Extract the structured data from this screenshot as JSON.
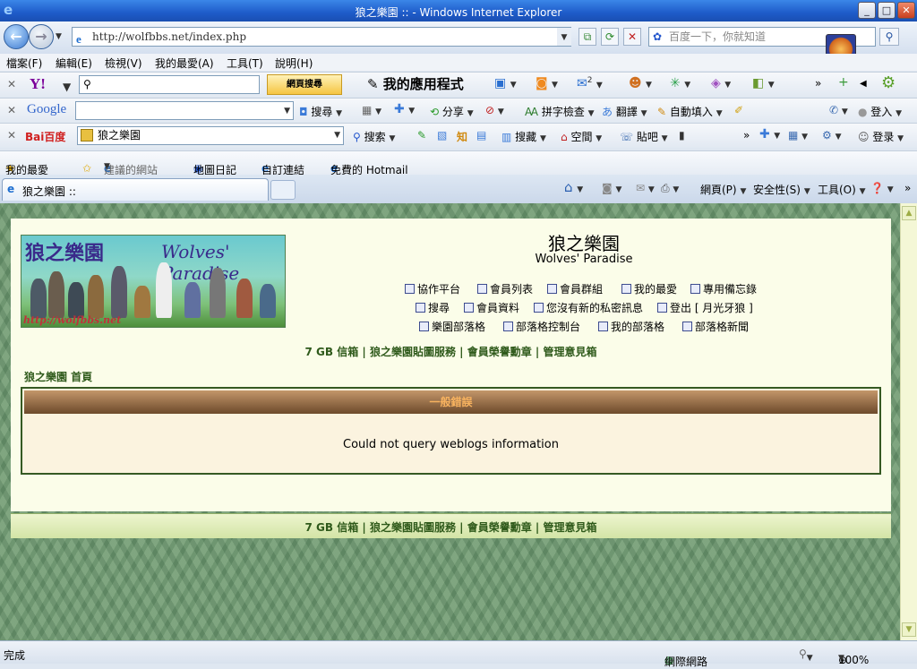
{
  "window": {
    "title": "狼之樂園 :: - Windows Internet Explorer"
  },
  "address": {
    "url": "http://wolfbbs.net/index.php",
    "search_placeholder": "百度一下，你就知道"
  },
  "menu": [
    "檔案(F)",
    "編輯(E)",
    "檢視(V)",
    "我的最愛(A)",
    "工具(T)",
    "說明(H)"
  ],
  "yahoo_toolbar": {
    "logo": "Y!",
    "search_button": "網頁搜尋",
    "apps_label": "我的應用程式",
    "mail_badge": "2"
  },
  "google_toolbar": {
    "logo": "Google",
    "search": "搜尋",
    "share": "分享",
    "spellcheck": "拼字檢查",
    "translate": "翻譯",
    "autofill": "自動填入",
    "login": "登入"
  },
  "baidu_toolbar": {
    "logo": "Bai百度",
    "field": "狼之樂園",
    "search": "搜索",
    "collect": "搜藏",
    "space": "空間",
    "tieba": "貼吧",
    "login": "登录"
  },
  "favorites": {
    "fav": "我的最愛",
    "suggested": "建議的網站",
    "map": "地圖日記",
    "custom": "自訂連結",
    "hotmail": "免費的 Hotmail"
  },
  "tab": {
    "title": "狼之樂園 ::"
  },
  "commandbar": {
    "page": "網頁(P)",
    "safety": "安全性(S)",
    "tools": "工具(O)"
  },
  "site": {
    "logo_cn": "狼之樂園",
    "logo_en": "Wolves' Paradise",
    "logo_url": "http://wolfbbs.net",
    "title": "狼之樂園",
    "subtitle": "Wolves' Paradise",
    "nav_row1": [
      "協作平台",
      "會員列表",
      "會員群組",
      "我的最愛",
      "專用備忘錄"
    ],
    "nav_row2": [
      "搜尋",
      "會員資料",
      "您沒有新的私密訊息",
      "登出 [ 月光牙狼 ]"
    ],
    "nav_row3": [
      "樂園部落格",
      "部落格控制台",
      "我的部落格",
      "部落格新聞"
    ],
    "bottom_links": "7 GB 信箱 | 狼之樂園貼圖服務 | 會員榮譽勳章 | 管理意見箱",
    "breadcrumb": "狼之樂園 首頁",
    "error_title": "一般錯誤",
    "error_message": "Could not query weblogs information"
  },
  "status": {
    "text": "完成",
    "zone": "網際網路",
    "zoom": "100%"
  }
}
